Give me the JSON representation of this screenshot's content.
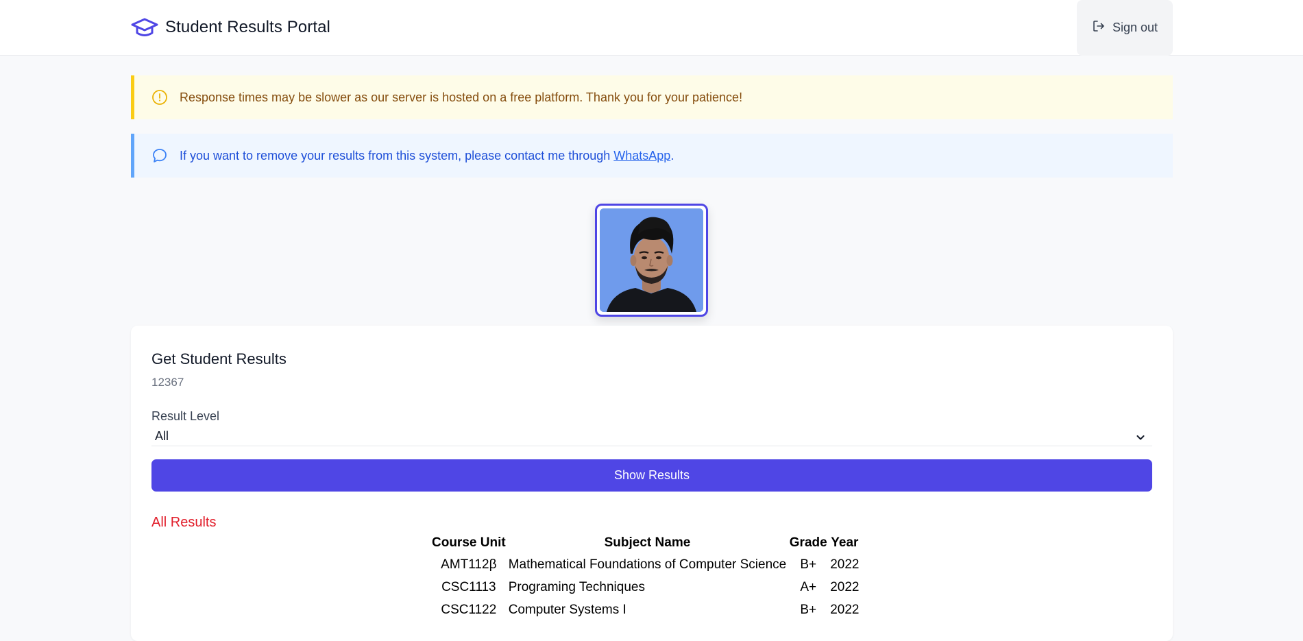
{
  "header": {
    "app_title": "Student Results Portal",
    "logo_icon": "graduation-cap-icon",
    "signout_label": "Sign out",
    "signout_icon": "sign-out-icon"
  },
  "alerts": {
    "warning_text": "Response times may be slower as our server is hosted on a free platform. Thank you for your patience!",
    "warning_icon": "exclamation-circle-icon",
    "info_text_before": "If you want to remove your results from this system, please contact me through ",
    "info_link": "WhatsApp",
    "info_text_after": ".",
    "info_icon": "chat-bubble-icon"
  },
  "profile": {
    "photo": "student-photo"
  },
  "card": {
    "title": "Get Student Results",
    "student_id": "12367",
    "level_label": "Result Level",
    "level_selected": "All",
    "button_label": "Show Results",
    "results_heading": "All Results"
  },
  "table": {
    "headers": [
      "Course Unit",
      "Subject Name",
      "Grade",
      "Year"
    ],
    "rows": [
      {
        "unit": "AMT112β",
        "name": "Mathematical Foundations of Computer Science",
        "grade": "B+",
        "year": "2022"
      },
      {
        "unit": "CSC1113",
        "name": "Programing Techniques",
        "grade": "A+",
        "year": "2022"
      },
      {
        "unit": "CSC1122",
        "name": "Computer Systems I",
        "grade": "B+",
        "year": "2022"
      }
    ]
  },
  "colors": {
    "accent": "#4f46e5",
    "warning_bg": "#fefce8",
    "warning_border": "#facc15",
    "info_bg": "#eff6ff",
    "info_border": "#60a5fa",
    "results_heading": "#e11d2a"
  }
}
